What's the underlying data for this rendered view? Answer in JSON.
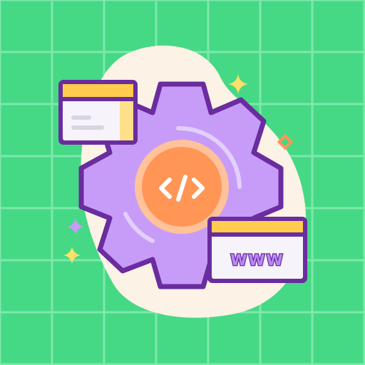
{
  "illustration": {
    "code_symbol": "</>",
    "web_label": "WWW",
    "icons": {
      "gear": "gear-icon",
      "code": "code-icon",
      "browser_window": "browser-window-icon",
      "sparkle": "sparkle-icon"
    }
  },
  "colors": {
    "background": "#45d985",
    "grid_line": "#7fe8ab",
    "blob": "#fcf2e6",
    "gear_fill": "#c79cf8",
    "gear_outline": "#6a2c9e",
    "hub_orange": "#ff9656",
    "hub_ring": "#ffc29a",
    "window_header": "#ffcc4d",
    "window_body": "#f6f3fa",
    "sparkle_yellow": "#ffe068",
    "sparkle_purple": "#c79cf8",
    "sparkle_orange": "#ff9656"
  }
}
